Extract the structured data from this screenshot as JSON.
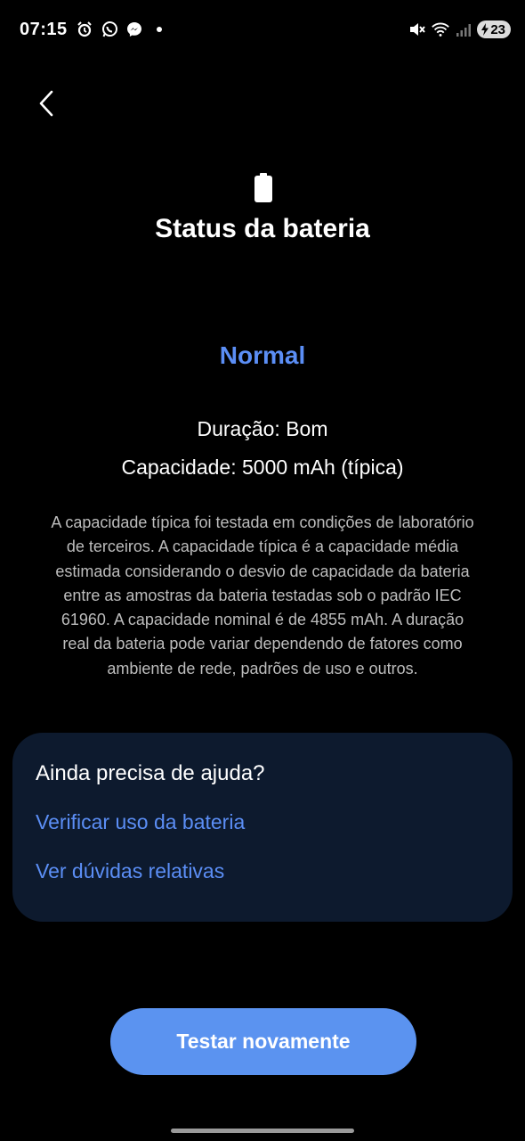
{
  "status_bar": {
    "time": "07:15",
    "battery_level": "23",
    "left_icons": [
      "alarm-icon",
      "whatsapp-icon",
      "messenger-icon",
      "dot-icon"
    ],
    "right_icons": [
      "mute-icon",
      "wifi-icon",
      "signal-icon",
      "battery-charging-icon"
    ]
  },
  "header": {
    "title": "Status da bateria",
    "icon": "battery-icon"
  },
  "status": {
    "value": "Normal",
    "duration": "Duração: Bom",
    "capacity": "Capacidade: 5000 mAh (típica)",
    "description": "A capacidade típica foi testada em condições de laboratório de terceiros. A capacidade típica é a capacidade média estimada considerando o desvio de capacidade da bateria entre as amostras da bateria testadas sob o padrão IEC 61960. A capacidade nominal é de 4855 mAh. A duração real da bateria pode variar dependendo de fatores como ambiente de rede, padrões de uso e outros."
  },
  "help": {
    "title": "Ainda precisa de ajuda?",
    "links": [
      "Verificar uso da bateria",
      "Ver dúvidas relativas"
    ]
  },
  "actions": {
    "retest_label": "Testar novamente"
  },
  "colors": {
    "background": "#000000",
    "accent": "#5b8ef5",
    "button": "#5b93f0",
    "card": "#0d1a2e"
  }
}
